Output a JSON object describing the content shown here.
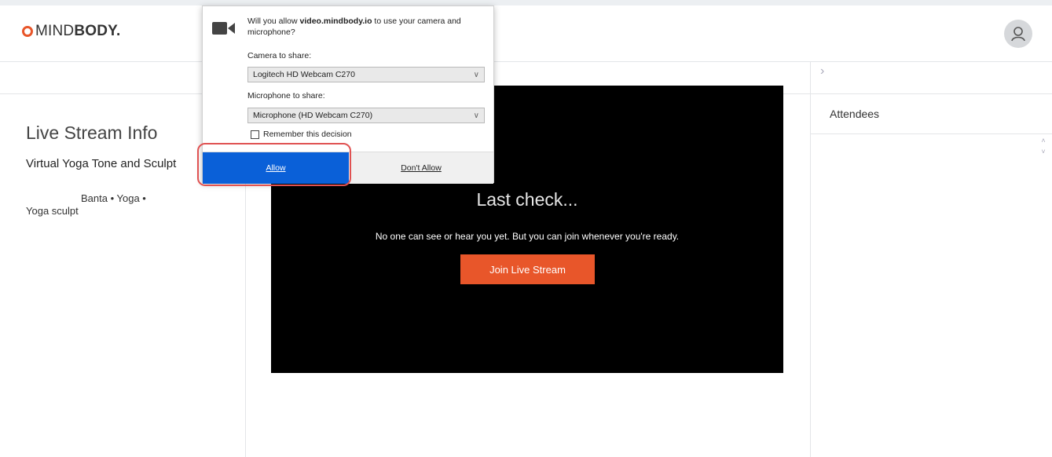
{
  "header": {
    "logo_light": "MIND",
    "logo_bold": "BODY.",
    "avatar_icon": "user-avatar-icon"
  },
  "colors": {
    "accent": "#e8562a",
    "allow_blue": "#0a60d8",
    "highlight_red": "#e05252"
  },
  "sidebar": {
    "title": "Live Stream Info",
    "class_name": "Virtual Yoga Tone and Sculpt",
    "tags_line1": "Banta • Yoga •",
    "tags_line2": "Yoga sculpt"
  },
  "video": {
    "heading": "Last check...",
    "subtext": "No one can see or hear you yet. But you can join whenever you're ready.",
    "join_button": "Join Live Stream"
  },
  "right_panel": {
    "toggle_icon": "chevron-right-icon",
    "attendees_label": "Attendees"
  },
  "permission_dialog": {
    "icon": "camera-icon",
    "question_prefix": "Will you allow ",
    "question_domain": "video.mindbody.io",
    "question_suffix": " to use your camera and microphone?",
    "camera_label": "Camera to share:",
    "camera_value": "Logitech HD Webcam C270",
    "microphone_label": "Microphone to share:",
    "microphone_value": "Microphone (HD Webcam C270)",
    "remember_label": "Remember this decision",
    "remember_checked": false,
    "allow_button": "Allow",
    "dont_allow_button": "Don't Allow"
  }
}
